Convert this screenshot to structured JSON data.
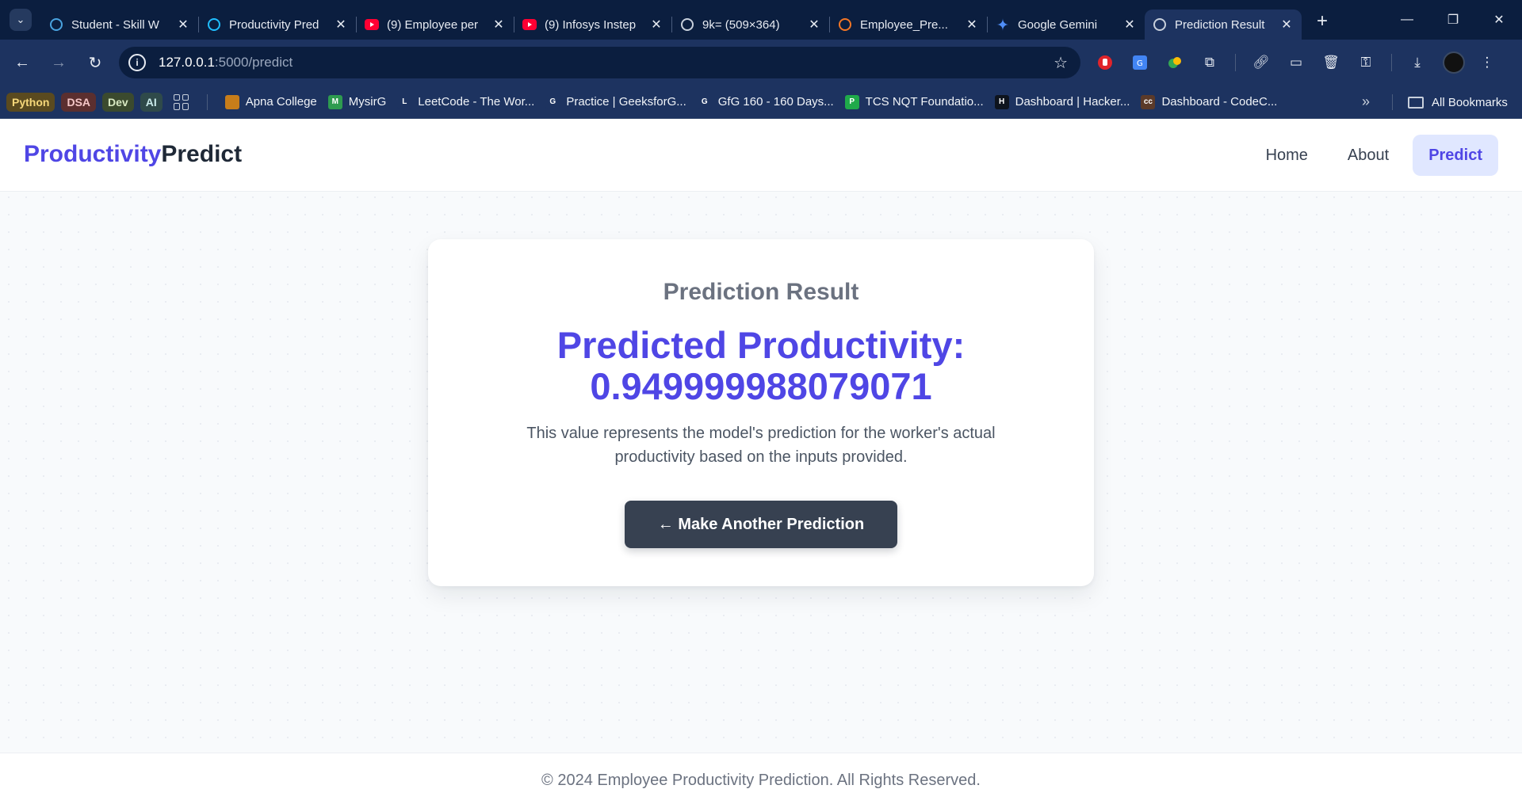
{
  "browser": {
    "tabs": [
      {
        "title": "Student - Skill W",
        "icon": "monitor-icon",
        "color": "#4aa3df"
      },
      {
        "title": "Productivity Pred",
        "icon": "kaggle-icon",
        "color": "#20beff"
      },
      {
        "title": "(9) Employee per",
        "icon": "youtube-icon",
        "color": "#ff0033"
      },
      {
        "title": "(9) Infosys Instep",
        "icon": "youtube-icon",
        "color": "#ff0033"
      },
      {
        "title": "9k= (509×364)",
        "icon": "globe-icon",
        "color": "#c8d0dc"
      },
      {
        "title": "Employee_Pre...",
        "icon": "jupyter-icon",
        "color": "#f37626"
      },
      {
        "title": "Google Gemini",
        "icon": "gemini-icon",
        "color": "#4f8ef7"
      },
      {
        "title": "Prediction Result",
        "icon": "globe-icon",
        "color": "#c8d0dc",
        "active": true
      }
    ],
    "url_host": "127.0.0.1",
    "url_rest": ":5000/predict",
    "bookmark_chips": [
      {
        "label": "Python",
        "bg": "#5a4a1f",
        "fg": "#f5d77a"
      },
      {
        "label": "DSA",
        "bg": "#5b2f2f",
        "fg": "#f4c6c6"
      },
      {
        "label": "Dev",
        "bg": "#3b4a2e",
        "fg": "#d8e8c2"
      },
      {
        "label": "AI",
        "bg": "#2f4a4a",
        "fg": "#c9eaea"
      }
    ],
    "bookmarks": [
      {
        "label": "Apna College",
        "icon_text": "",
        "bg": "#c77d1a"
      },
      {
        "label": "MysirG",
        "icon_text": "M",
        "bg": "#2e9b4f"
      },
      {
        "label": "LeetCode - The Wor...",
        "icon_text": "L",
        "bg": "#1d3360"
      },
      {
        "label": "Practice | GeeksforG...",
        "icon_text": "G",
        "bg": "#1d3360"
      },
      {
        "label": "GfG 160 - 160 Days...",
        "icon_text": "G",
        "bg": "#1d3360"
      },
      {
        "label": "TCS NQT Foundatio...",
        "icon_text": "P",
        "bg": "#1faa4a"
      },
      {
        "label": "Dashboard | Hacker...",
        "icon_text": "H",
        "bg": "#0e141e"
      },
      {
        "label": "Dashboard - CodeC...",
        "icon_text": "cc",
        "bg": "#5b3a29"
      }
    ],
    "all_bookmarks": "All Bookmarks"
  },
  "site": {
    "brand_accent": "Productivity",
    "brand_rest": "Predict",
    "nav": [
      "Home",
      "About",
      "Predict"
    ],
    "active_nav": "Predict"
  },
  "result": {
    "heading": "Prediction Result",
    "label": "Predicted Productivity:",
    "value": "0.949999988079071",
    "description": "This value represents the model's prediction for the worker's actual productivity based on the inputs provided.",
    "button": "← Make Another Prediction"
  },
  "footer": "© 2024 Employee Productivity Prediction. All Rights Reserved.",
  "colors": {
    "accent": "#4f46e5",
    "button": "#374151",
    "chrome": "#1d3360"
  }
}
